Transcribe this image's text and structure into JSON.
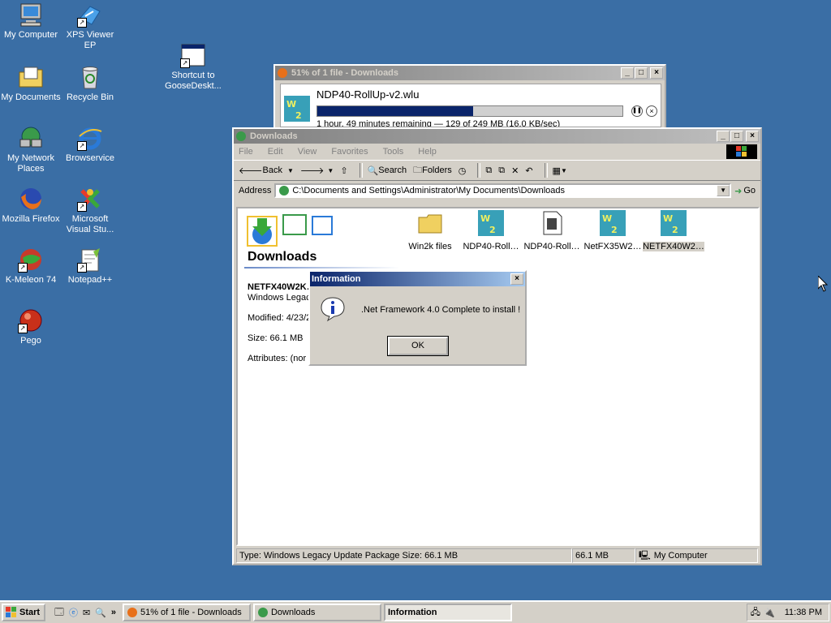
{
  "desktop": {
    "icons": [
      {
        "name": "my-computer",
        "label": "My Computer"
      },
      {
        "name": "xps-viewer",
        "label": "XPS Viewer EP"
      },
      {
        "name": "shortcut-goose",
        "label": "Shortcut to GooseDeskt..."
      },
      {
        "name": "my-documents",
        "label": "My Documents"
      },
      {
        "name": "recycle-bin",
        "label": "Recycle Bin"
      },
      {
        "name": "my-network-places",
        "label": "My Network Places"
      },
      {
        "name": "browservice",
        "label": "Browservice"
      },
      {
        "name": "mozilla-firefox",
        "label": "Mozilla Firefox"
      },
      {
        "name": "visual-studio",
        "label": "Microsoft Visual Stu..."
      },
      {
        "name": "k-meleon",
        "label": "K-Meleon 74"
      },
      {
        "name": "notepadpp",
        "label": "Notepad++"
      },
      {
        "name": "pego",
        "label": "Pego"
      }
    ]
  },
  "download_window": {
    "title": "51% of 1 file - Downloads",
    "file_name": "NDP40-RollUp-v2.wlu",
    "progress_pct": 51,
    "status": "1 hour, 49 minutes remaining — 129 of 249 MB (16.0 KB/sec)"
  },
  "explorer": {
    "title": "Downloads",
    "menu": [
      "File",
      "Edit",
      "View",
      "Favorites",
      "Tools",
      "Help"
    ],
    "toolbar": {
      "back": "Back",
      "search": "Search",
      "folders": "Folders"
    },
    "address_label": "Address",
    "address_value": "C:\\Documents and Settings\\Administrator\\My Documents\\Downloads",
    "go_label": "Go",
    "panel_heading": "Downloads",
    "selected_name": "NETFX40W2K…",
    "selected_type": "Windows Legacy",
    "modified": "Modified: 4/23/2",
    "size": "Size: 66.1 MB",
    "attributes": "Attributes: (nor",
    "files": [
      {
        "label": "Win2k files",
        "kind": "folder"
      },
      {
        "label": "NDP40-Roll…",
        "kind": "win2k"
      },
      {
        "label": "NDP40-Roll…",
        "kind": "doc"
      },
      {
        "label": "NetFX35W2…",
        "kind": "win2k"
      },
      {
        "label": "NETFX40W2…",
        "kind": "win2k",
        "selected": true
      }
    ],
    "status_type": "Type: Windows Legacy Update Package Size: 66.1 MB",
    "status_size": "66.1 MB",
    "status_zone": "My Computer"
  },
  "dialog": {
    "title": "Information",
    "message": ".Net Framework 4.0 Complete to install !",
    "ok_label": "OK"
  },
  "taskbar": {
    "start_label": "Start",
    "buttons": [
      "51% of 1 file - Downloads",
      "Downloads",
      "Information"
    ],
    "clock": "11:38 PM"
  },
  "colors": {
    "desktop": "#3a6ea5",
    "title_active": "#0a246a",
    "progress": "#0a246a"
  }
}
